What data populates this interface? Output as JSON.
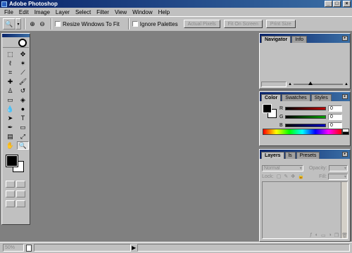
{
  "window": {
    "title": "Adobe Photoshop",
    "controls": [
      "minimize",
      "maximize",
      "close"
    ]
  },
  "menubar": {
    "items": [
      "File",
      "Edit",
      "Image",
      "Layer",
      "Select",
      "Filter",
      "View",
      "Window",
      "Help"
    ]
  },
  "options_bar": {
    "resize_windows_label": "Resize Windows To Fit",
    "ignore_palettes_label": "Ignore Palettes",
    "actual_pixels_label": "Actual Pixels",
    "fit_on_screen_label": "Fit On Screen",
    "print_size_label": "Print Size"
  },
  "navigator_panel": {
    "tabs": [
      "Navigator",
      "Info"
    ]
  },
  "color_panel": {
    "tabs": [
      "Color",
      "Swatches",
      "Styles"
    ],
    "channels": [
      {
        "label": "R",
        "value": "0"
      },
      {
        "label": "G",
        "value": "0"
      },
      {
        "label": "B",
        "value": "0"
      }
    ],
    "colors": {
      "red": "#c00000",
      "green": "#00a000",
      "blue": "#0000c0"
    }
  },
  "layers_panel": {
    "tabs": [
      "Layers",
      "ls",
      "Presets"
    ],
    "blend_mode": "Normal",
    "opacity_label": "Opacity:",
    "lock_label": "Lock:",
    "fill_label": "Fill:"
  },
  "status": {
    "zoom": "50%"
  },
  "colors": {
    "title_start": "#0a246a",
    "title_end": "#3a6ea5",
    "workspace": "#808080",
    "chrome": "#c0c0c0"
  }
}
